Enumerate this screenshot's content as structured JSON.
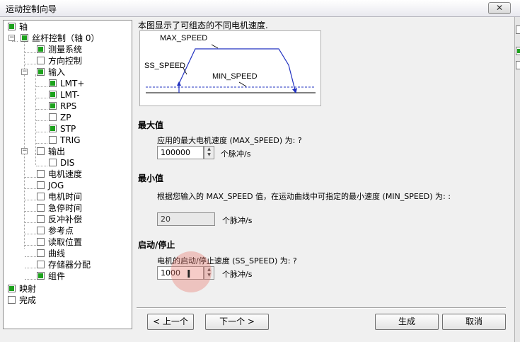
{
  "window": {
    "title": "运动控制向导",
    "close_glyph": "✕"
  },
  "tree": {
    "nodes": [
      {
        "label": "轴",
        "checked": true
      },
      {
        "label": "丝杆控制（轴 0）",
        "checked": true
      },
      {
        "label": "测量系统",
        "checked": true
      },
      {
        "label": "方向控制",
        "checked": false
      },
      {
        "label": "输入",
        "checked": true
      },
      {
        "label": "LMT+",
        "checked": true
      },
      {
        "label": "LMT-",
        "checked": true
      },
      {
        "label": "RPS",
        "checked": true
      },
      {
        "label": "ZP",
        "checked": false
      },
      {
        "label": "STP",
        "checked": true
      },
      {
        "label": "TRIG",
        "checked": false
      },
      {
        "label": "输出",
        "checked": false
      },
      {
        "label": "DIS",
        "checked": false
      },
      {
        "label": "电机速度",
        "checked": false
      },
      {
        "label": "JOG",
        "checked": false
      },
      {
        "label": "电机时间",
        "checked": false
      },
      {
        "label": "急停时间",
        "checked": false
      },
      {
        "label": "反冲补偿",
        "checked": false
      },
      {
        "label": "参考点",
        "checked": false
      },
      {
        "label": "读取位置",
        "checked": false
      },
      {
        "label": "曲线",
        "checked": false
      },
      {
        "label": "存储器分配",
        "checked": false
      },
      {
        "label": "组件",
        "checked": true
      },
      {
        "label": "映射",
        "checked": true
      },
      {
        "label": "完成",
        "checked": false
      }
    ]
  },
  "diagram": {
    "intro": "本图显示了可组态的不同电机速度.",
    "max_label": "MAX_SPEED",
    "ss_label": "SS_SPEED",
    "min_label": "MIN_SPEED"
  },
  "max_section": {
    "title": "最大值",
    "prompt": "应用的最大电机速度 (MAX_SPEED) 为: ?",
    "value": "100000",
    "unit": "个脉冲/s"
  },
  "min_section": {
    "title": "最小值",
    "prompt": "根据您输入的 MAX_SPEED 值，在运动曲线中可指定的最小速度 (MIN_SPEED) 为: :",
    "value": "20",
    "unit": "个脉冲/s"
  },
  "ss_section": {
    "title": "启动/停止",
    "prompt": "电机的启动/停止速度 (SS_SPEED) 为: ?",
    "value": "1000",
    "unit": "个脉冲/s"
  },
  "buttons": {
    "prev": "< 上一个",
    "next": "下一个 >",
    "generate": "生成",
    "cancel": "取消"
  },
  "cursor": {
    "glyph": "I"
  },
  "colors": {
    "check_green": "#1da21d",
    "diagram_blue": "#2030c0"
  }
}
